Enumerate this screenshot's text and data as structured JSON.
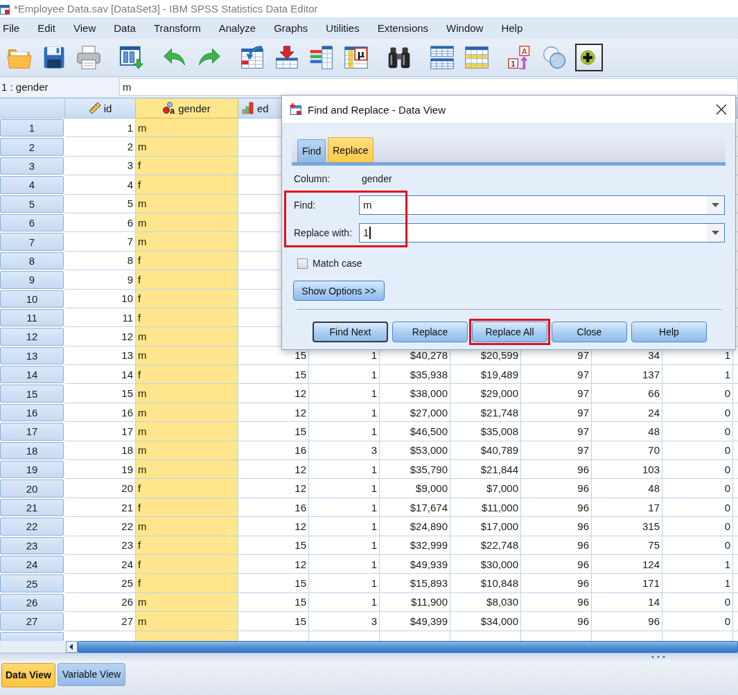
{
  "window": {
    "title": "*Employee Data.sav [DataSet3] - IBM SPSS Statistics Data Editor"
  },
  "menu": [
    "File",
    "Edit",
    "View",
    "Data",
    "Transform",
    "Analyze",
    "Graphs",
    "Utilities",
    "Extensions",
    "Window",
    "Help"
  ],
  "toolbar": [
    [
      {
        "kind": "open",
        "pressed": false
      },
      {
        "kind": "save",
        "pressed": false
      },
      {
        "kind": "print",
        "pressed": false
      }
    ],
    [
      {
        "kind": "recall",
        "pressed": false
      }
    ],
    [
      {
        "kind": "undo",
        "pressed": false
      },
      {
        "kind": "redo",
        "pressed": false
      }
    ],
    [
      {
        "kind": "goto",
        "pressed": false
      },
      {
        "kind": "insertcases",
        "pressed": false
      },
      {
        "kind": "insertvariable",
        "pressed": false
      },
      {
        "kind": "mu",
        "pressed": false,
        "glyphs": [
          "μ"
        ]
      }
    ],
    [
      {
        "kind": "find",
        "pressed": false
      }
    ],
    [
      {
        "kind": "split",
        "pressed": false
      },
      {
        "kind": "weight",
        "pressed": false
      }
    ],
    [
      {
        "kind": "labels",
        "pressed": false,
        "glyphs": [
          "A",
          "1"
        ]
      },
      {
        "kind": "sets",
        "pressed": false
      },
      {
        "kind": "addon",
        "pressed": true
      }
    ]
  ],
  "cell_editor": {
    "reference": "1 : gender",
    "value": "m"
  },
  "table": {
    "columns": [
      {
        "name": "id",
        "kind": "scale",
        "selected": false
      },
      {
        "name": "gender",
        "kind": "string",
        "glyph": "a",
        "selected": true
      },
      {
        "name": "ed",
        "kind": "ordinal",
        "selected": false
      }
    ],
    "rows": [
      {
        "number": "1",
        "cells": [
          "1",
          "m"
        ]
      },
      {
        "number": "2",
        "cells": [
          "2",
          "m"
        ]
      },
      {
        "number": "3",
        "cells": [
          "3",
          "f"
        ]
      },
      {
        "number": "4",
        "cells": [
          "4",
          "f"
        ]
      },
      {
        "number": "5",
        "cells": [
          "5",
          "m"
        ]
      },
      {
        "number": "6",
        "cells": [
          "6",
          "m"
        ]
      },
      {
        "number": "7",
        "cells": [
          "7",
          "m"
        ]
      },
      {
        "number": "8",
        "cells": [
          "8",
          "f"
        ]
      },
      {
        "number": "9",
        "cells": [
          "9",
          "f"
        ]
      },
      {
        "number": "10",
        "cells": [
          "10",
          "f"
        ]
      },
      {
        "number": "11",
        "cells": [
          "11",
          "f"
        ]
      },
      {
        "number": "12",
        "cells": [
          "12",
          "m"
        ]
      },
      {
        "number": "13",
        "cells": [
          "13",
          "m",
          "15",
          "1",
          "$40,278",
          "$20,599",
          "97",
          "34",
          "1"
        ]
      },
      {
        "number": "14",
        "cells": [
          "14",
          "f",
          "15",
          "1",
          "$35,938",
          "$19,489",
          "97",
          "137",
          "1"
        ]
      },
      {
        "number": "15",
        "cells": [
          "15",
          "m",
          "12",
          "1",
          "$38,000",
          "$29,000",
          "97",
          "66",
          "0"
        ]
      },
      {
        "number": "16",
        "cells": [
          "16",
          "m",
          "12",
          "1",
          "$27,000",
          "$21,748",
          "97",
          "24",
          "0"
        ]
      },
      {
        "number": "17",
        "cells": [
          "17",
          "m",
          "15",
          "1",
          "$46,500",
          "$35,008",
          "97",
          "48",
          "0"
        ]
      },
      {
        "number": "18",
        "cells": [
          "18",
          "m",
          "16",
          "3",
          "$53,000",
          "$40,789",
          "97",
          "70",
          "0"
        ]
      },
      {
        "number": "19",
        "cells": [
          "19",
          "m",
          "12",
          "1",
          "$35,790",
          "$21,844",
          "96",
          "103",
          "0"
        ]
      },
      {
        "number": "20",
        "cells": [
          "20",
          "f",
          "12",
          "1",
          "$9,000",
          "$7,000",
          "96",
          "48",
          "0"
        ]
      },
      {
        "number": "21",
        "cells": [
          "21",
          "f",
          "16",
          "1",
          "$17,674",
          "$11,000",
          "96",
          "17",
          "0"
        ]
      },
      {
        "number": "22",
        "cells": [
          "22",
          "m",
          "12",
          "1",
          "$24,890",
          "$17,000",
          "96",
          "315",
          "0"
        ]
      },
      {
        "number": "23",
        "cells": [
          "23",
          "f",
          "15",
          "1",
          "$32,999",
          "$22,748",
          "96",
          "75",
          "0"
        ]
      },
      {
        "number": "24",
        "cells": [
          "24",
          "f",
          "12",
          "1",
          "$49,939",
          "$30,000",
          "96",
          "124",
          "1"
        ]
      },
      {
        "number": "25",
        "cells": [
          "25",
          "f",
          "15",
          "1",
          "$15,893",
          "$10,848",
          "96",
          "171",
          "1"
        ]
      },
      {
        "number": "26",
        "cells": [
          "26",
          "m",
          "15",
          "1",
          "$11,900",
          "$8,030",
          "96",
          "14",
          "0"
        ]
      },
      {
        "number": "27",
        "cells": [
          "27",
          "m",
          "15",
          "3",
          "$49,399",
          "$34,000",
          "96",
          "96",
          "0"
        ]
      }
    ]
  },
  "view_tabs": [
    {
      "label": "Data View",
      "selected": true
    },
    {
      "label": "Variable View",
      "selected": false
    }
  ],
  "dialog": {
    "title": "Find and Replace - Data View",
    "tabs": [
      {
        "label": "Find",
        "selected": false
      },
      {
        "label": "Replace",
        "selected": true
      }
    ],
    "column": {
      "label": "Column:",
      "value": "gender"
    },
    "search": {
      "highlighted": true,
      "fields": [
        {
          "label": "Find:",
          "value": "m",
          "focused": false
        },
        {
          "label": "Replace with:",
          "value": "1",
          "focused": true
        }
      ]
    },
    "match_case": {
      "label": "Match case",
      "checked": false
    },
    "options_button": "Show Options >>",
    "buttons": [
      {
        "label": "Find Next",
        "default": true,
        "highlighted": false
      },
      {
        "label": "Replace",
        "default": false,
        "highlighted": false
      },
      {
        "label": "Replace All",
        "default": false,
        "highlighted": true
      },
      {
        "label": "Close",
        "default": false,
        "highlighted": false
      },
      {
        "label": "Help",
        "default": false,
        "highlighted": false
      }
    ]
  }
}
